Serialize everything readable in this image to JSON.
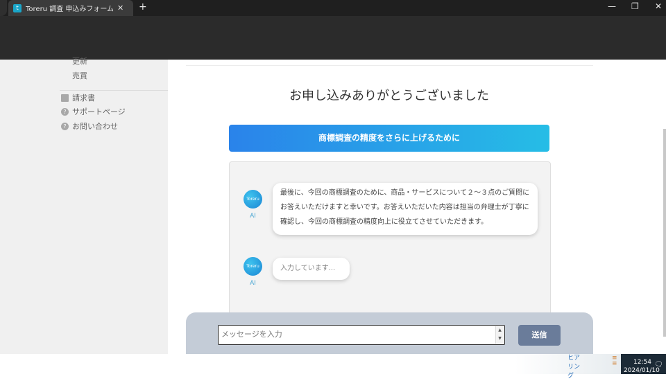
{
  "browser": {
    "tab_title": "Toreru 調査 申込みフォーム | Tore",
    "favicon_letter": "t",
    "tab_close": "✕",
    "new_tab": "+",
    "win_min": "—",
    "win_restore": "❐",
    "win_close": "✕"
  },
  "sidebar": {
    "sub_items": [
      "更新",
      "売買"
    ],
    "items": [
      {
        "label": "請求書",
        "icon": "document-icon"
      },
      {
        "label": "サポートページ",
        "icon": "help-icon"
      },
      {
        "label": "お問い合わせ",
        "icon": "help-icon"
      }
    ]
  },
  "main": {
    "title": "お申し込みありがとうございました",
    "banner": "商標調査の精度をさらに上げるために",
    "messages": [
      {
        "sender": "AI",
        "avatar": "Toreru",
        "text": "最後に、今回の商標調査のために、商品・サービスについて２〜３点のご質問にお答えいただけますと幸いです。お答えいただいた内容は担当の弁理士が丁寧に確認し、今回の商標調査の精度向上に役立てさせていただきます。"
      },
      {
        "sender": "AI",
        "avatar": "Toreru",
        "text": "入力しています..."
      }
    ]
  },
  "input": {
    "placeholder": "メッセージを入力",
    "send_label": "送信"
  },
  "taskbar": {
    "hearing": "ヒアリング",
    "time": "12:54",
    "date": "2024/01/10"
  },
  "colors": {
    "banner_start": "#2a83ea",
    "banner_end": "#26bde6",
    "send_button": "#6a7c9a"
  }
}
